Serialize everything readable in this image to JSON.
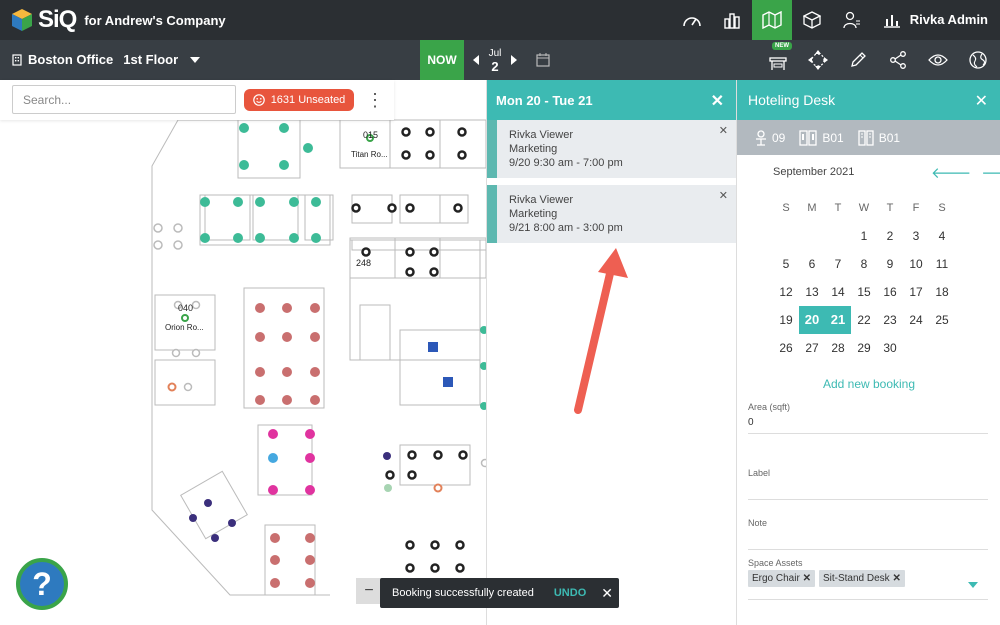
{
  "app": {
    "logo_text": "SiQ",
    "company": "for Andrew's Company",
    "user": "Rivka Admin"
  },
  "top_icons": [
    "dashboard-icon",
    "buildings-icon",
    "floorplan-icon",
    "box-icon",
    "person-list-icon",
    "bar-chart-icon"
  ],
  "subbar": {
    "building": "Boston Office",
    "floor": "1st Floor",
    "now_label": "NOW",
    "month": "Jul",
    "day": "2",
    "new_badge": "NEW"
  },
  "search": {
    "placeholder": "Search...",
    "unseated_label": "1631 Unseated"
  },
  "floor_labels": {
    "room_015": "015",
    "room_015_name": "Titan Ro...",
    "room_040": "040",
    "room_040_name": "Orion Ro...",
    "room_248": "248"
  },
  "bookings_panel": {
    "title": "Mon 20 - Tue 21",
    "bookings": [
      {
        "name": "Rivka Viewer",
        "dept": "Marketing",
        "time": "9/20 9:30 am - 7:00 pm"
      },
      {
        "name": "Rivka Viewer",
        "dept": "Marketing",
        "time": "9/21 8:00 am - 3:00 pm"
      }
    ]
  },
  "desk_panel": {
    "title": "Hoteling Desk",
    "seat": "09",
    "desk1": "B01",
    "desk2": "B01",
    "calendar": {
      "month": "September 2021",
      "dow": [
        "S",
        "M",
        "T",
        "W",
        "T",
        "F",
        "S"
      ],
      "weeks": [
        [
          "",
          "",
          "",
          "1",
          "2",
          "3",
          "4"
        ],
        [
          "5",
          "6",
          "7",
          "8",
          "9",
          "10",
          "11"
        ],
        [
          "12",
          "13",
          "14",
          "15",
          "16",
          "17",
          "18"
        ],
        [
          "19",
          "20",
          "21",
          "22",
          "23",
          "24",
          "25"
        ],
        [
          "26",
          "27",
          "28",
          "29",
          "30",
          "",
          ""
        ]
      ],
      "selected": [
        "20",
        "21"
      ]
    },
    "add_booking": "Add new booking",
    "area_label": "Area (sqft)",
    "area_value": "0",
    "label_label": "Label",
    "note_label": "Note",
    "assets_label": "Space Assets",
    "assets": [
      "Ergo Chair",
      "Sit-Stand Desk"
    ]
  },
  "toast": {
    "message": "Booking successfully created",
    "undo": "UNDO"
  },
  "help": {
    "label": "?"
  },
  "zoom": {
    "minus": "−"
  },
  "colors": {
    "teal": "#3dbab3",
    "green": "#3aa449",
    "dark": "#2b2f33",
    "orange": "#e8553d"
  }
}
